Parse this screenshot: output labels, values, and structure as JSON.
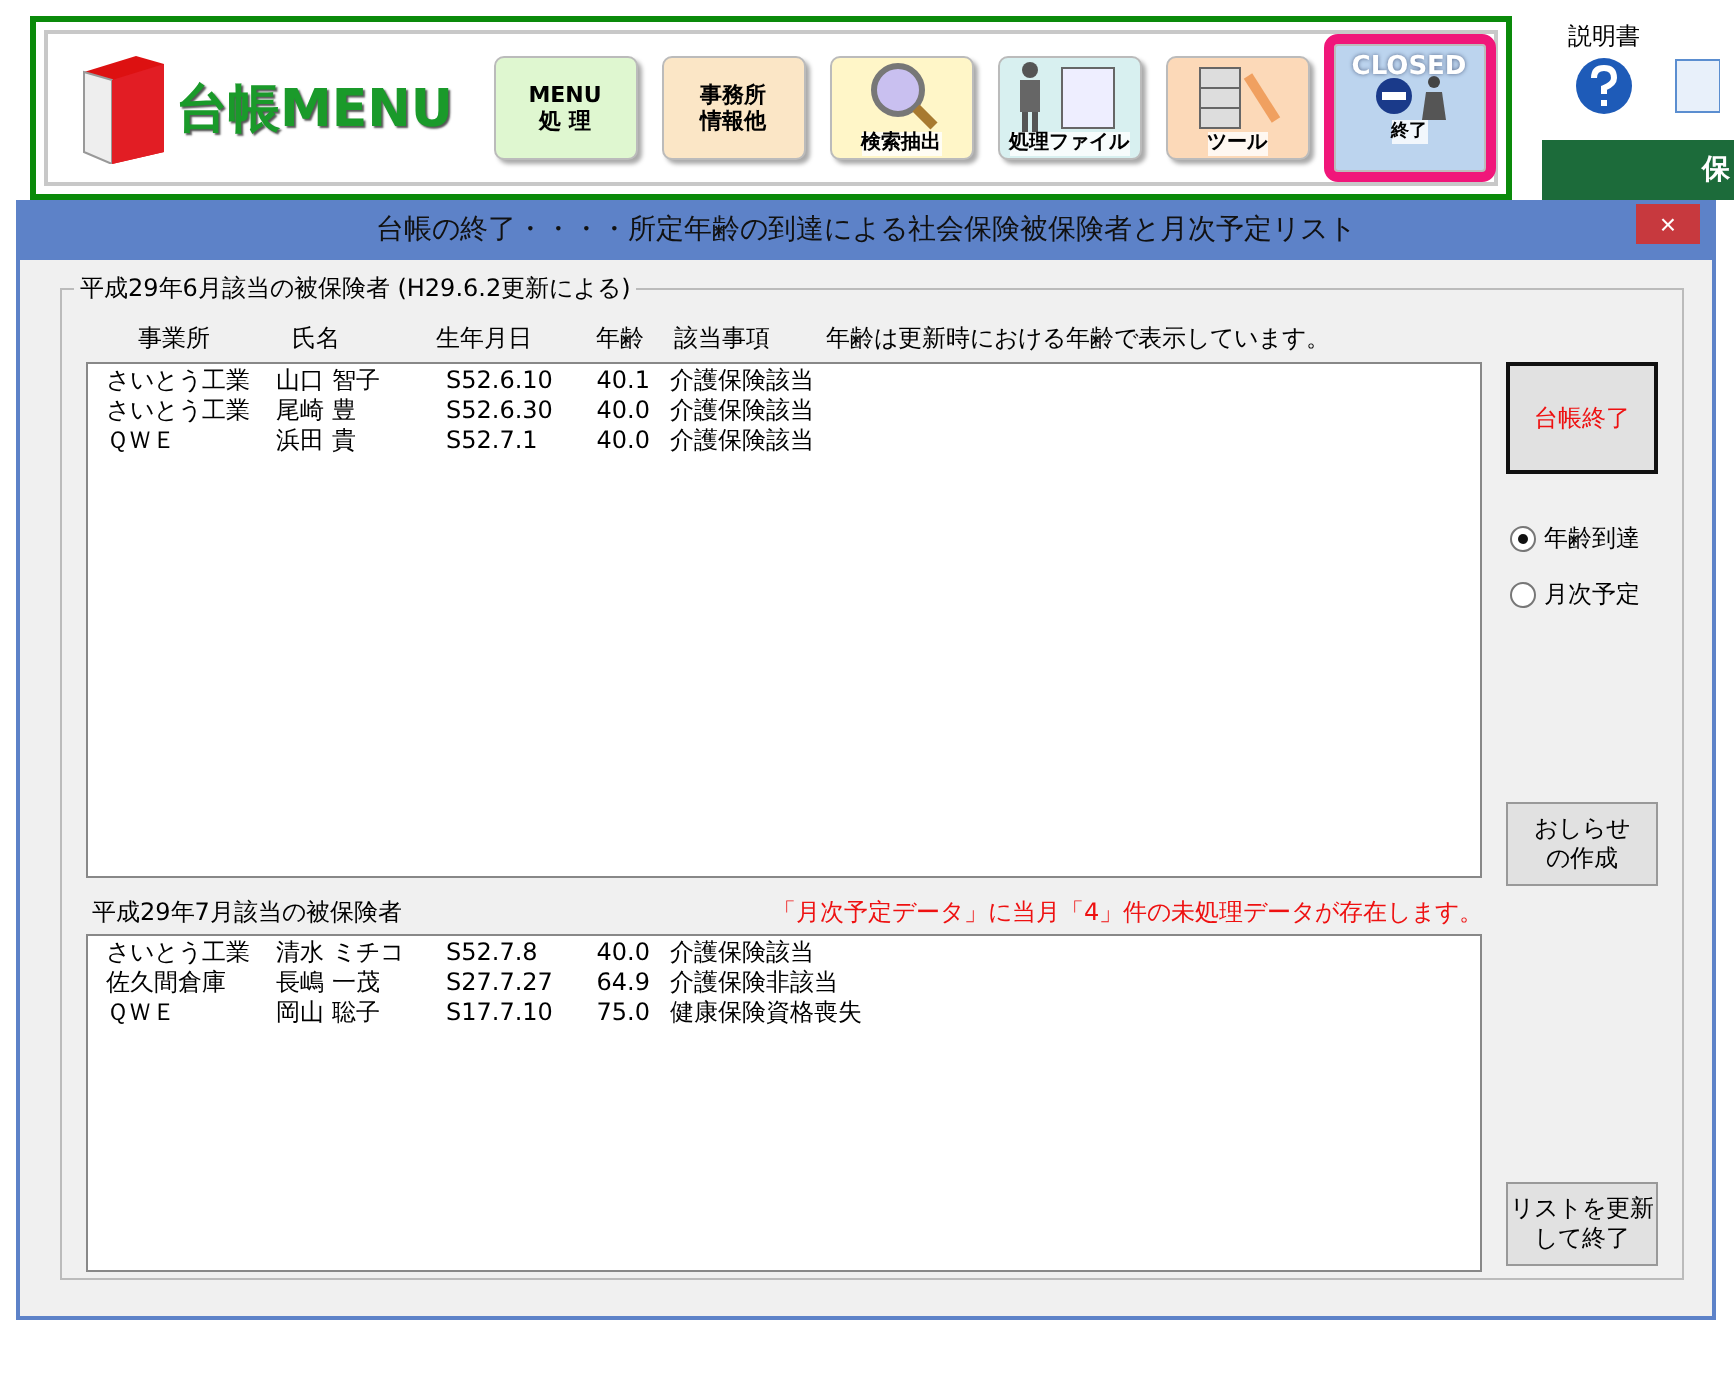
{
  "menu": {
    "logo_text": "台帳MENU",
    "buttons": [
      {
        "kind": "text",
        "lines": [
          "MENU",
          "処 理"
        ],
        "selected": false
      },
      {
        "kind": "text",
        "lines": [
          "事務所",
          "情報他"
        ],
        "selected": false
      },
      {
        "kind": "search",
        "lines": [
          "検索抽出"
        ],
        "selected": false
      },
      {
        "kind": "file",
        "lines": [
          "処理ファイル"
        ],
        "selected": false
      },
      {
        "kind": "tool",
        "lines": [
          "ツール"
        ],
        "selected": false
      },
      {
        "kind": "closed",
        "lines": [
          "CLOSED",
          "終了"
        ],
        "selected": true
      }
    ]
  },
  "help": {
    "label": "説明書"
  },
  "sheet_header": {
    "label": "保"
  },
  "dialog": {
    "title": "台帳の終了・・・・所定年齢の到達による社会保険被保険者と月次予定リスト",
    "close": "×",
    "current": {
      "legend": "平成29年6月該当の被保険者 (H29.6.2更新による)",
      "columns": [
        "事業所",
        "氏名",
        "生年月日",
        "年齢",
        "該当事項"
      ],
      "note": "年齢は更新時における年齢で表示しています。",
      "rows": [
        {
          "cells": [
            "さいとう工業",
            "山口 智子",
            "S52.6.10",
            "40.1",
            "介護保険該当"
          ]
        },
        {
          "cells": [
            "さいとう工業",
            "尾崎 豊",
            "S52.6.30",
            "40.0",
            "介護保険該当"
          ]
        },
        {
          "cells": [
            "ＱＷＥ",
            "浜田 貴",
            "S52.7.1",
            "40.0",
            "介護保険該当"
          ]
        }
      ]
    },
    "next": {
      "legend": "平成29年7月該当の被保険者",
      "warning": "「月次予定データ」に当月「4」件の未処理データが存在します。",
      "rows": [
        {
          "cells": [
            "さいとう工業",
            "清水 ミチコ",
            "S52.7.8",
            "40.0",
            "介護保険該当"
          ]
        },
        {
          "cells": [
            "佐久間倉庫",
            "長嶋 一茂",
            "S27.7.27",
            "64.9",
            "介護保険非該当"
          ]
        },
        {
          "cells": [
            "ＱＷＥ",
            "岡山 聡子",
            "S17.7.10",
            "75.0",
            "健康保険資格喪失"
          ]
        }
      ]
    },
    "close_button": "台帳終了",
    "radios": [
      {
        "label": "年齢到達",
        "selected": true
      },
      {
        "label": "月次予定",
        "selected": false
      }
    ],
    "notice_button": [
      "おしらせ",
      "の作成"
    ],
    "refresh_button": [
      "リストを更新",
      "して終了"
    ]
  }
}
